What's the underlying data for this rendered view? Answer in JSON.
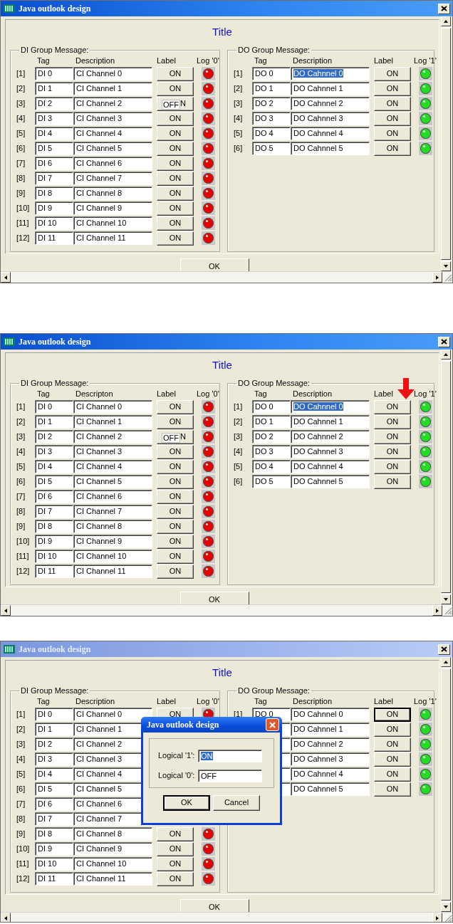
{
  "windows": [
    {
      "title": "Java outlook design",
      "active": true,
      "heading": "Title",
      "pointer_arrow": false,
      "ok": "OK",
      "groups": [
        {
          "legend": "DI Group Message:",
          "columns": [
            "Tag",
            "Description",
            "Label",
            "Log '0'"
          ],
          "rows": [
            {
              "index": "[1]",
              "tag": "DI 0",
              "description": "CI Channel 0",
              "description_selected": false,
              "label": "ON",
              "label_focused": false,
              "color": "#e60000"
            },
            {
              "index": "[2]",
              "tag": "DI 1",
              "description": "CI Channel 1",
              "description_selected": false,
              "label": "ON",
              "label_focused": false,
              "color": "#e60000"
            },
            {
              "index": "[3]",
              "tag": "DI 2",
              "description": "CI Channel 2",
              "description_selected": false,
              "label": "N",
              "editor": "OFF",
              "label_focused": false,
              "color": "#e60000"
            },
            {
              "index": "[4]",
              "tag": "DI 3",
              "description": "CI Channel 3",
              "description_selected": false,
              "label": "ON",
              "label_focused": false,
              "color": "#e60000"
            },
            {
              "index": "[5]",
              "tag": "DI 4",
              "description": "CI Channel 4",
              "description_selected": false,
              "label": "ON",
              "label_focused": false,
              "color": "#e60000"
            },
            {
              "index": "[6]",
              "tag": "DI 5",
              "description": "CI Channel 5",
              "description_selected": false,
              "label": "ON",
              "label_focused": false,
              "color": "#e60000"
            },
            {
              "index": "[7]",
              "tag": "DI 6",
              "description": "CI Channel 6",
              "description_selected": false,
              "label": "ON",
              "label_focused": false,
              "color": "#e60000"
            },
            {
              "index": "[8]",
              "tag": "DI 7",
              "description": "CI Channel 7",
              "description_selected": false,
              "label": "ON",
              "label_focused": false,
              "color": "#e60000"
            },
            {
              "index": "[9]",
              "tag": "DI 8",
              "description": "CI Channel 8",
              "description_selected": false,
              "label": "ON",
              "label_focused": false,
              "color": "#e60000"
            },
            {
              "index": "[10]",
              "tag": "DI 9",
              "description": "CI Channel 9",
              "description_selected": false,
              "label": "ON",
              "label_focused": false,
              "color": "#e60000"
            },
            {
              "index": "[11]",
              "tag": "DI 10",
              "description": "CI Channel 10",
              "description_selected": false,
              "label": "ON",
              "label_focused": false,
              "color": "#e60000"
            },
            {
              "index": "[12]",
              "tag": "DI 11",
              "description": "CI Channel 11",
              "description_selected": false,
              "label": "ON",
              "label_focused": false,
              "color": "#e60000"
            }
          ]
        },
        {
          "legend": "DO Group Message:",
          "columns": [
            "Tag",
            "Description",
            "Label",
            "Log '1'"
          ],
          "rows": [
            {
              "index": "[1]",
              "tag": "DO 0",
              "description": "DO Cahnnel 0",
              "description_selected": true,
              "label": "ON",
              "label_focused": false,
              "color": "#22dd22"
            },
            {
              "index": "[2]",
              "tag": "DO 1",
              "description": "DO Cahnnel 1",
              "description_selected": false,
              "label": "ON",
              "label_focused": false,
              "color": "#22dd22"
            },
            {
              "index": "[3]",
              "tag": "DO 2",
              "description": "DO Cahnnel 2",
              "description_selected": false,
              "label": "ON",
              "label_focused": false,
              "color": "#22dd22"
            },
            {
              "index": "[4]",
              "tag": "DO 3",
              "description": "DO Cahnnel 3",
              "description_selected": false,
              "label": "ON",
              "label_focused": false,
              "color": "#22dd22"
            },
            {
              "index": "[5]",
              "tag": "DO 4",
              "description": "DO Cahnnel 4",
              "description_selected": false,
              "label": "ON",
              "label_focused": false,
              "color": "#22dd22"
            },
            {
              "index": "[6]",
              "tag": "DO 5",
              "description": "DO Cahnnel 5",
              "description_selected": false,
              "label": "ON",
              "label_focused": false,
              "color": "#22dd22"
            }
          ]
        }
      ]
    },
    {
      "title": "Java outlook design",
      "active": true,
      "heading": "Title",
      "pointer_arrow": true,
      "ok": "OK",
      "groups": [
        {
          "legend": "DI Group Message:",
          "columns": [
            "Tag",
            "Descripton",
            "Label",
            "Log '0'"
          ],
          "rows": [
            {
              "index": "[1]",
              "tag": "DI 0",
              "description": "CI Channel 0",
              "description_selected": false,
              "label": "ON",
              "label_focused": false,
              "color": "#e60000"
            },
            {
              "index": "[2]",
              "tag": "DI 1",
              "description": "CI Channel 1",
              "description_selected": false,
              "label": "ON",
              "label_focused": false,
              "color": "#e60000"
            },
            {
              "index": "[3]",
              "tag": "DI 2",
              "description": "CI Channel 2",
              "description_selected": false,
              "label": "N",
              "editor": "OFF",
              "label_focused": false,
              "color": "#e60000"
            },
            {
              "index": "[4]",
              "tag": "DI 3",
              "description": "CI Channel 3",
              "description_selected": false,
              "label": "ON",
              "label_focused": false,
              "color": "#e60000"
            },
            {
              "index": "[5]",
              "tag": "DI 4",
              "description": "CI Channel 4",
              "description_selected": false,
              "label": "ON",
              "label_focused": false,
              "color": "#e60000"
            },
            {
              "index": "[6]",
              "tag": "DI 5",
              "description": "CI Channel 5",
              "description_selected": false,
              "label": "ON",
              "label_focused": false,
              "color": "#e60000"
            },
            {
              "index": "[7]",
              "tag": "DI 6",
              "description": "CI Channel 6",
              "description_selected": false,
              "label": "ON",
              "label_focused": false,
              "color": "#e60000"
            },
            {
              "index": "[8]",
              "tag": "DI 7",
              "description": "CI Channel 7",
              "description_selected": false,
              "label": "ON",
              "label_focused": false,
              "color": "#e60000"
            },
            {
              "index": "[9]",
              "tag": "DI 8",
              "description": "CI Channel 8",
              "description_selected": false,
              "label": "ON",
              "label_focused": false,
              "color": "#e60000"
            },
            {
              "index": "[10]",
              "tag": "DI 9",
              "description": "CI Channel 9",
              "description_selected": false,
              "label": "ON",
              "label_focused": false,
              "color": "#e60000"
            },
            {
              "index": "[11]",
              "tag": "DI 10",
              "description": "CI Channel 10",
              "description_selected": false,
              "label": "ON",
              "label_focused": false,
              "color": "#e60000"
            },
            {
              "index": "[12]",
              "tag": "DI 11",
              "description": "CI Channel 11",
              "description_selected": false,
              "label": "ON",
              "label_focused": false,
              "color": "#e60000"
            }
          ]
        },
        {
          "legend": "DO Group Message:",
          "columns": [
            "Tag",
            "Description",
            "Label",
            "Log '1'"
          ],
          "rows": [
            {
              "index": "[1]",
              "tag": "DO 0",
              "description": "DO Cahnnel 0",
              "description_selected": true,
              "label": "ON",
              "label_focused": false,
              "color": "#22dd22"
            },
            {
              "index": "[2]",
              "tag": "DO 1",
              "description": "DO Cahnnel 1",
              "description_selected": false,
              "label": "ON",
              "label_focused": false,
              "color": "#22dd22"
            },
            {
              "index": "[3]",
              "tag": "DO 2",
              "description": "DO Cahnnel 2",
              "description_selected": false,
              "label": "ON",
              "label_focused": false,
              "color": "#22dd22"
            },
            {
              "index": "[4]",
              "tag": "DO 3",
              "description": "DO Cahnnel 3",
              "description_selected": false,
              "label": "ON",
              "label_focused": false,
              "color": "#22dd22"
            },
            {
              "index": "[5]",
              "tag": "DO 4",
              "description": "DO Cahnnel 4",
              "description_selected": false,
              "label": "ON",
              "label_focused": false,
              "color": "#22dd22"
            },
            {
              "index": "[6]",
              "tag": "DO 5",
              "description": "DO Cahnnel 5",
              "description_selected": false,
              "label": "ON",
              "label_focused": false,
              "color": "#22dd22"
            }
          ]
        }
      ]
    },
    {
      "title": "Java outlook design",
      "active": false,
      "heading": "Title",
      "pointer_arrow": false,
      "ok": "OK",
      "groups": [
        {
          "legend": "DI Group Message:",
          "columns": [
            "Tag",
            "Description",
            "Label",
            "Log '0'"
          ],
          "rows": [
            {
              "index": "[1]",
              "tag": "DI 0",
              "description": "CI Channel 0",
              "description_selected": false,
              "label": "ON",
              "label_focused": false,
              "color": "#e60000"
            },
            {
              "index": "[2]",
              "tag": "DI 1",
              "description": "CI Channel 1",
              "description_selected": false
            },
            {
              "index": "[3]",
              "tag": "DI 2",
              "description": "CI Channel 2",
              "description_selected": false
            },
            {
              "index": "[4]",
              "tag": "DI 3",
              "description": "CI Channel 3",
              "description_selected": false
            },
            {
              "index": "[5]",
              "tag": "DI 4",
              "description": "CI Channel 4",
              "description_selected": false
            },
            {
              "index": "[6]",
              "tag": "DI 5",
              "description": "CI Channel 5",
              "description_selected": false
            },
            {
              "index": "[7]",
              "tag": "DI 6",
              "description": "CI Channel 6",
              "description_selected": false
            },
            {
              "index": "[8]",
              "tag": "DI 7",
              "description": "CI Channel 7",
              "description_selected": false
            },
            {
              "index": "[9]",
              "tag": "DI 8",
              "description": "CI Channel 8",
              "description_selected": false,
              "label": "ON",
              "label_focused": false,
              "color": "#e60000"
            },
            {
              "index": "[10]",
              "tag": "DI 9",
              "description": "CI Channel 9",
              "description_selected": false,
              "label": "ON",
              "label_focused": false,
              "color": "#e60000"
            },
            {
              "index": "[11]",
              "tag": "DI 10",
              "description": "CI Channel 10",
              "description_selected": false,
              "label": "ON",
              "label_focused": false,
              "color": "#e60000"
            },
            {
              "index": "[12]",
              "tag": "DI 11",
              "description": "CI Channel 11",
              "description_selected": false,
              "label": "ON",
              "label_focused": false,
              "color": "#e60000"
            }
          ]
        },
        {
          "legend": "DO Group Message:",
          "columns": [
            "Tag",
            "Description",
            "Label",
            "Log '1'"
          ],
          "rows": [
            {
              "index": "[1]",
              "tag": "DO 0",
              "description": "DO Cahnnel 0",
              "description_selected": false,
              "label": "ON",
              "label_focused": true,
              "color": "#22dd22"
            },
            {
              "description": "DO Cahnnel 1",
              "description_selected": false,
              "label": "ON",
              "label_focused": false,
              "color": "#22dd22"
            },
            {
              "description": "DO Cahnnel 2",
              "description_selected": false,
              "label": "ON",
              "label_focused": false,
              "color": "#22dd22"
            },
            {
              "description": "DO Cahnnel 3",
              "description_selected": false,
              "label": "ON",
              "label_focused": false,
              "color": "#22dd22"
            },
            {
              "description": "DO Cahnnel 4",
              "description_selected": false,
              "label": "ON",
              "label_focused": false,
              "color": "#22dd22"
            },
            {
              "description": "DO Cahnnel 5",
              "description_selected": false,
              "label": "ON",
              "label_focused": false,
              "color": "#22dd22"
            }
          ]
        }
      ],
      "dialog": {
        "title": "Java outlook design",
        "fields": [
          {
            "label": "Logical '1':",
            "value": "ON",
            "selected": true
          },
          {
            "label": "Logical '0':",
            "value": "OFF",
            "selected": false
          }
        ],
        "buttons": [
          {
            "text": "OK",
            "focused": true
          },
          {
            "text": "Cancel",
            "focused": false
          }
        ]
      }
    }
  ]
}
